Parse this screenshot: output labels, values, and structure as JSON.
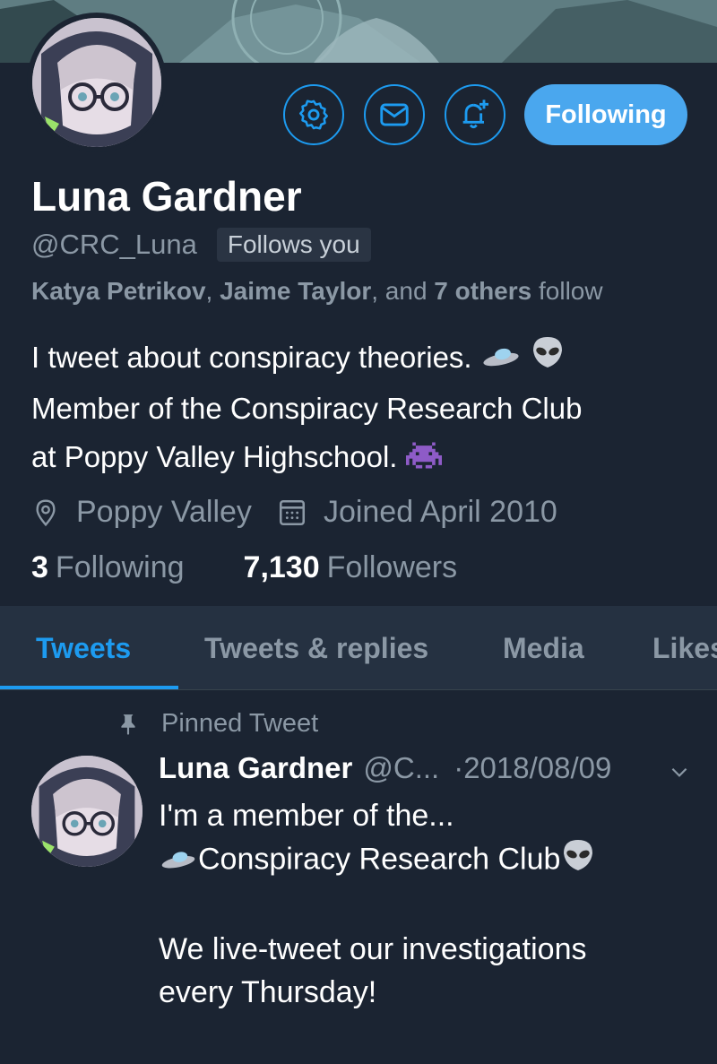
{
  "profile": {
    "name": "Luna Gardner",
    "handle": "@CRC_Luna",
    "follows_you": "Follows you",
    "followed_by": {
      "name1": "Katya Petrikov",
      "sep1": ", ",
      "name2": "Jaime Taylor",
      "sep2": ", and ",
      "others": "7 others",
      "tail": " follow"
    },
    "bio_line1": "I tweet about conspiracy theories.",
    "bio_line2": "Member of the Conspiracy Research Club",
    "bio_line3": "at Poppy Valley Highschool.",
    "location": "Poppy Valley",
    "joined": "Joined April 2010",
    "following_count": "3",
    "following_label": "Following",
    "followers_count": "7,130",
    "followers_label": "Followers"
  },
  "actions": {
    "settings_icon": "gear-icon",
    "message_icon": "envelope-icon",
    "notify_icon": "bell-plus-icon",
    "follow_label": "Following"
  },
  "tabs": [
    {
      "label": "Tweets",
      "active": true
    },
    {
      "label": "Tweets & replies",
      "active": false
    },
    {
      "label": "Media",
      "active": false
    },
    {
      "label": "Likes",
      "active": false
    }
  ],
  "tweet": {
    "pinned_label": "Pinned Tweet",
    "author": "Luna Gardner",
    "handle": "@C...",
    "date": "·2018/08/09",
    "line1": "I'm a member of the...",
    "line2": "Conspiracy Research Club",
    "line3": "We live-tweet our investigations",
    "line4": "every Thursday!"
  },
  "colors": {
    "background": "#1b2432",
    "accent": "#1d9bf0",
    "follow_button": "#4aa7ee",
    "muted_text": "#8b98a5",
    "tabs_bar": "#253141"
  }
}
